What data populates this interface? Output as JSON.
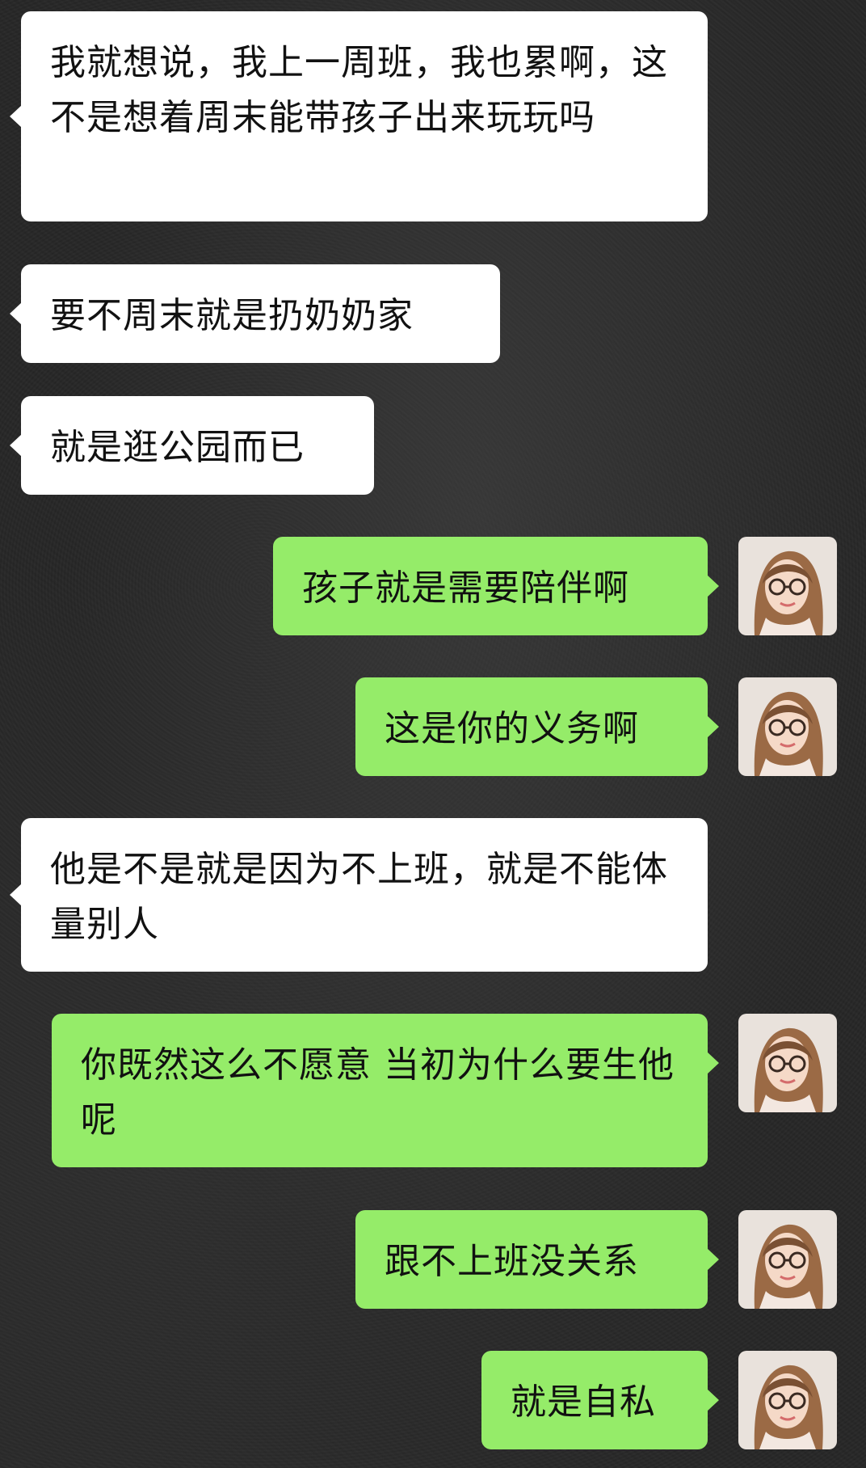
{
  "chat": {
    "messages": [
      {
        "side": "left",
        "text": "我就想说，我上一周班，我也累啊，这不是想着周末能带孩子出来玩玩吗"
      },
      {
        "side": "left",
        "text": "要不周末就是扔奶奶家"
      },
      {
        "side": "left",
        "text": "就是逛公园而已"
      },
      {
        "side": "right",
        "text": "孩子就是需要陪伴啊"
      },
      {
        "side": "right",
        "text": "这是你的义务啊"
      },
      {
        "side": "left",
        "text": "他是不是就是因为不上班，就是不能体量别人"
      },
      {
        "side": "right",
        "text": "你既然这么不愿意 当初为什么要生他呢"
      },
      {
        "side": "right",
        "text": "跟不上班没关系"
      },
      {
        "side": "right",
        "text": "就是自私"
      }
    ]
  },
  "colors": {
    "background": "#262626",
    "incoming_bubble": "#ffffff",
    "outgoing_bubble": "#95ec69",
    "text": "#111111"
  },
  "icons": {
    "avatar": "user-avatar-photo"
  }
}
